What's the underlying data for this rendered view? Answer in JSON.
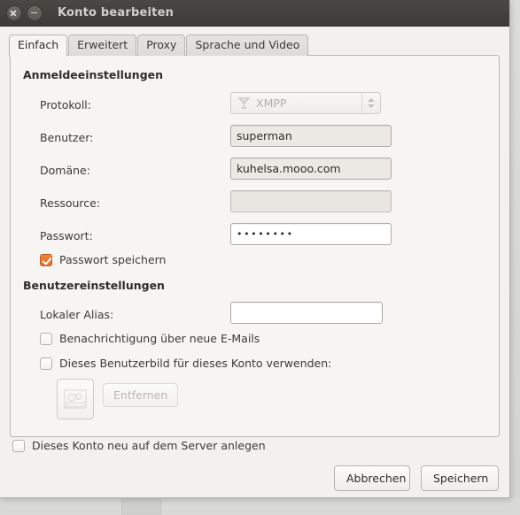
{
  "window": {
    "title": "Konto bearbeiten",
    "close_icon": "close-icon",
    "minimize_icon": "minimize-icon"
  },
  "tabs": [
    {
      "label": "Einfach",
      "active": true
    },
    {
      "label": "Erweitert",
      "active": false
    },
    {
      "label": "Proxy",
      "active": false
    },
    {
      "label": "Sprache und Video",
      "active": false
    }
  ],
  "login_section": {
    "title": "Anmeldeeinstellungen",
    "protocol": {
      "label": "Protokoll:",
      "value": "XMPP",
      "icon": "xmpp-icon",
      "disabled": true
    },
    "user": {
      "label": "Benutzer:",
      "value": "superman",
      "placeholder": ""
    },
    "domain": {
      "label": "Domäne:",
      "value": "kuhelsa.mooo.com",
      "placeholder": ""
    },
    "resource": {
      "label": "Ressource:",
      "value": "",
      "placeholder": ""
    },
    "password": {
      "label": "Passwort:",
      "value": "••••••••",
      "placeholder": ""
    },
    "save_password": {
      "label": "Passwort speichern",
      "checked": true
    }
  },
  "user_section": {
    "title": "Benutzereinstellungen",
    "local_alias": {
      "label": "Lokaler Alias:",
      "value": "",
      "placeholder": ""
    },
    "notify_mail": {
      "label": "Benachrichtigung über neue E-Mails",
      "checked": false
    },
    "use_avatar": {
      "label": "Dieses Benutzerbild für dieses Konto verwenden:",
      "checked": false
    },
    "avatar_icon": "image-placeholder-icon",
    "remove_button": "Entfernen"
  },
  "footer": {
    "register_account": {
      "label": "Dieses Konto neu auf dem Server anlegen",
      "checked": false
    },
    "cancel_label": "Abbrechen",
    "save_label": "Speichern"
  },
  "colors": {
    "accent": "#e2702a",
    "titlebar": "#3d3b38",
    "panel": "#f6f5f4",
    "window": "#f2f1f0"
  }
}
